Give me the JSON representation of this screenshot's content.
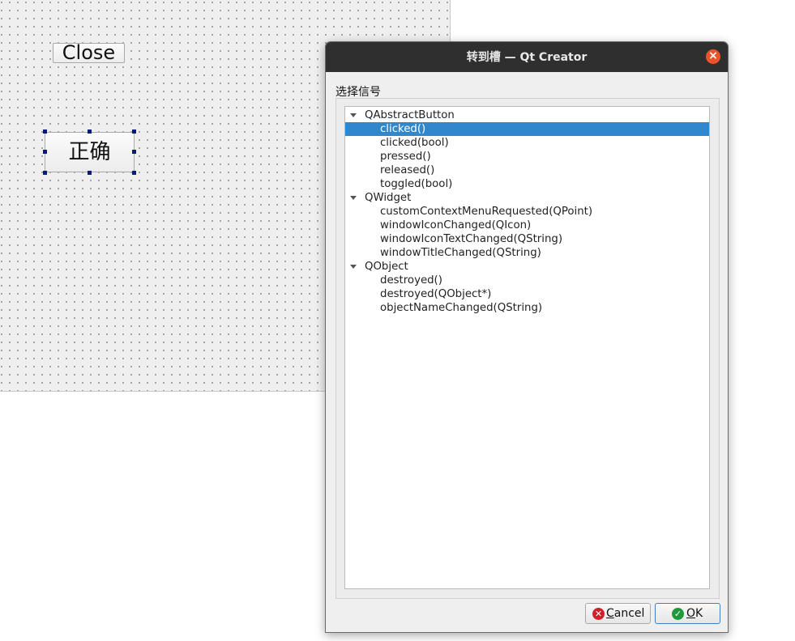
{
  "form": {
    "close_button_label": "Close",
    "ok_button_label": "正确"
  },
  "dialog": {
    "title": "转到槽 — Qt Creator",
    "group_label": "选择信号",
    "tree": [
      {
        "class": "QAbstractButton",
        "signals": [
          "clicked()",
          "clicked(bool)",
          "pressed()",
          "released()",
          "toggled(bool)"
        ]
      },
      {
        "class": "QWidget",
        "signals": [
          "customContextMenuRequested(QPoint)",
          "windowIconChanged(QIcon)",
          "windowIconTextChanged(QString)",
          "windowTitleChanged(QString)"
        ]
      },
      {
        "class": "QObject",
        "signals": [
          "destroyed()",
          "destroyed(QObject*)",
          "objectNameChanged(QString)"
        ]
      }
    ],
    "selected_signal": "clicked()",
    "cancel_button": {
      "mnemonic": "C",
      "rest": "ancel"
    },
    "ok_button": {
      "mnemonic": "O",
      "rest": "K"
    }
  },
  "colors": {
    "titlebar": "#2f2f2f",
    "selection": "#3187cb",
    "close_icon": "#e9542d"
  },
  "icons": {
    "title_close": "close-icon",
    "cancel": "cancel-icon",
    "ok": "check-icon",
    "expand": "expand-arrow-icon"
  }
}
